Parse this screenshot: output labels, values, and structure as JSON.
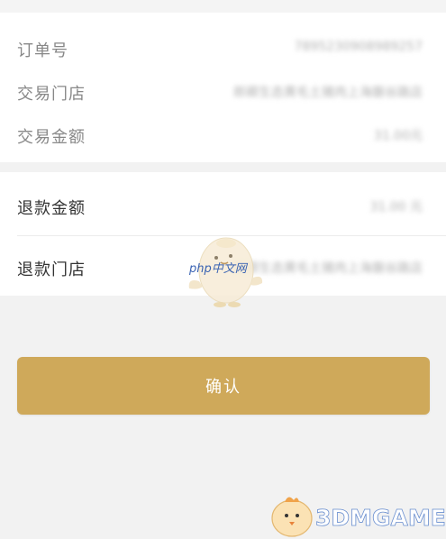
{
  "order_info": {
    "rows": [
      {
        "label": "订单号",
        "value": "7895230908989257"
      },
      {
        "label": "交易门店",
        "value": "郎卿生态黄毛土猪肉上海磐谷路店"
      },
      {
        "label": "交易金额",
        "value": "31.00元"
      }
    ]
  },
  "refund_info": {
    "rows": [
      {
        "label": "退款金额",
        "value": "31.00 元"
      },
      {
        "label": "退款门店",
        "value": "郎卿生态黄毛土猪肉上海磐谷路店"
      }
    ]
  },
  "confirm_button": {
    "label": "确认"
  },
  "watermarks": {
    "center_text": "php中文网",
    "bottom_text": "3DMGAME"
  },
  "colors": {
    "accent": "#cfa95a",
    "background": "#f2f2f2"
  }
}
